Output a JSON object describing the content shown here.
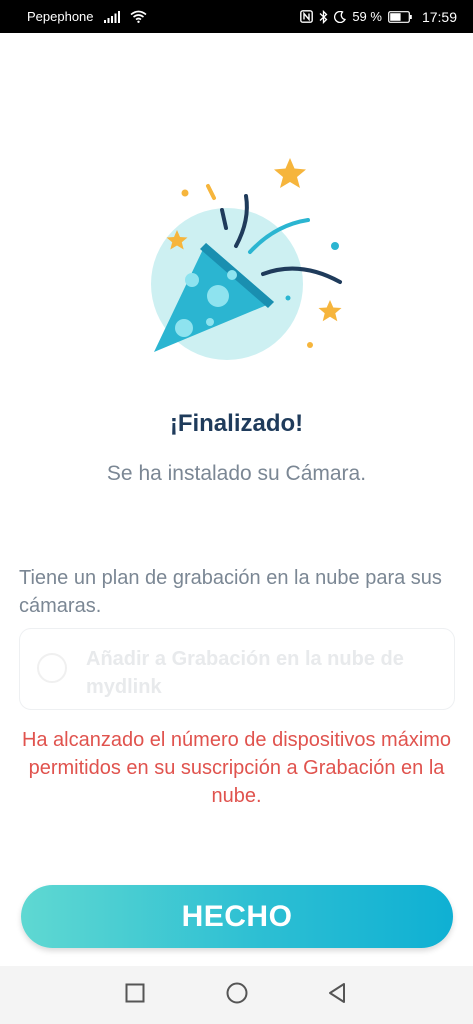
{
  "status_bar": {
    "carrier": "Pepephone",
    "battery_percent": "59 %",
    "time": "17:59",
    "battery_level": 0.59
  },
  "icons": {
    "signal": "signal-icon",
    "wifi": "wifi-icon",
    "nfc": "nfc-icon",
    "bluetooth": "bluetooth-icon",
    "dnd": "moon-icon",
    "battery": "battery-icon",
    "illustration": "party-popper-icon",
    "nav_recents": "square-icon",
    "nav_home": "circle-icon",
    "nav_back": "triangle-back-icon"
  },
  "main": {
    "title": "¡Finalizado!",
    "subtitle": "Se ha instalado su Cámara.",
    "question": "Tiene un plan de grabación en la nube para sus cámaras.",
    "option_label": "Añadir a Grabación en la nube de mydlink",
    "error_message": "Ha alcanzado el número de dispositivos máximo permitidos en su suscripción a Grabación en la nube.",
    "done_label": "HECHO"
  },
  "colors": {
    "title": "#1f3b5b",
    "error": "#e0534e",
    "button_start": "#5fd8d2",
    "button_end": "#0fb0d3",
    "accent_teal": "#2bb5d1",
    "star": "#f6b53c"
  }
}
